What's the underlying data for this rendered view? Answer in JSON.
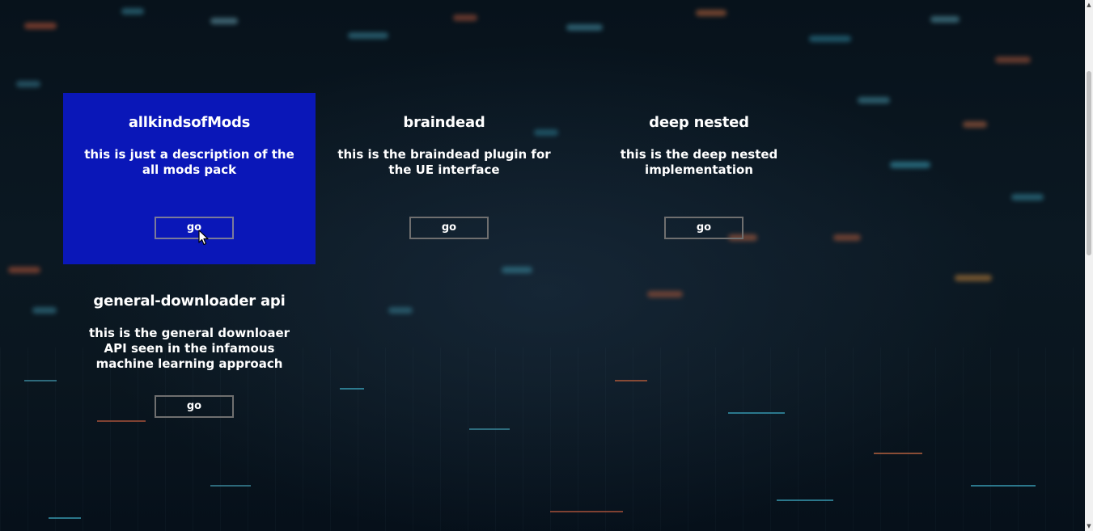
{
  "cards": [
    {
      "title": "allkindsofMods",
      "description": "this is just a description of the all mods pack",
      "button_label": "go",
      "state": "hovered"
    },
    {
      "title": "braindead",
      "description": "this is the braindead plugin for the UE interface",
      "button_label": "go"
    },
    {
      "title": "deep nested",
      "description": "this is the deep nested implementation",
      "button_label": "go"
    },
    {
      "title": "general-downloader api",
      "description": "this is the general downloaer API seen in the infamous machine learning approach",
      "button_label": "go"
    }
  ],
  "colors": {
    "active_card": "#0a17b8",
    "background": "#0a161f",
    "text": "#ffffff"
  },
  "icons": {
    "cursor": "mouse-pointer-icon",
    "scroll_up": "scroll-up-arrow-icon",
    "scroll_down": "scroll-down-arrow-icon"
  }
}
